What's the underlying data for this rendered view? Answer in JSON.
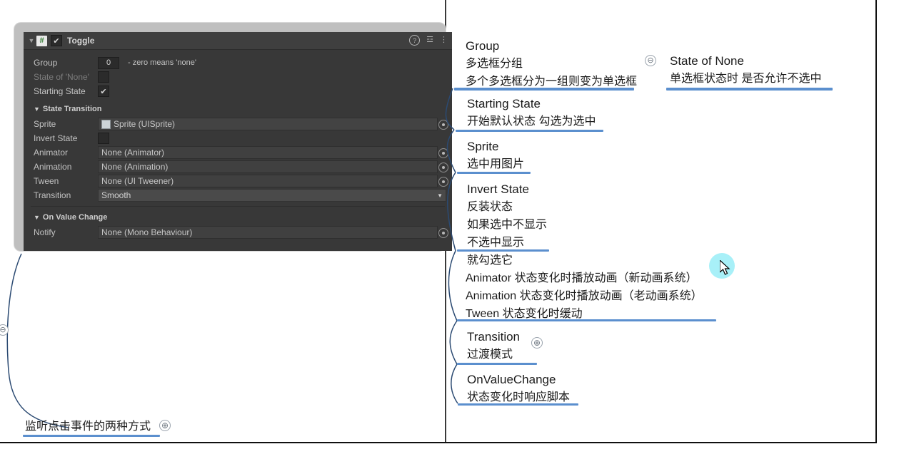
{
  "inspector": {
    "title": "Toggle",
    "foldout_arrow": "▼",
    "script_icon_glyph": "#",
    "enabled_check": "✔",
    "header_icons": {
      "help": "?",
      "preset": "☲",
      "menu": "⋮"
    },
    "rows": [
      {
        "label": "Group",
        "value": "0",
        "hint": "- zero means 'none'"
      },
      {
        "label": "State of 'None'",
        "value": "",
        "hint": ""
      },
      {
        "label": "Starting State",
        "value": "✔",
        "hint": ""
      }
    ],
    "sections": [
      {
        "title": "State Transition",
        "fields": [
          {
            "label": "Sprite",
            "value": "Sprite (UISprite)",
            "kind": "object-sprite"
          },
          {
            "label": "Invert State",
            "value": "",
            "kind": "checkbox"
          },
          {
            "label": "Animator",
            "value": "None (Animator)",
            "kind": "object"
          },
          {
            "label": "Animation",
            "value": "None (Animation)",
            "kind": "object"
          },
          {
            "label": "Tween",
            "value": "None (UI Tweener)",
            "kind": "object"
          },
          {
            "label": "Transition",
            "value": "Smooth",
            "kind": "dropdown"
          }
        ]
      },
      {
        "title": "On Value Change",
        "fields": [
          {
            "label": "Notify",
            "value": "None (Mono Behaviour)",
            "kind": "object"
          }
        ]
      }
    ],
    "dropdown_caret": "▼"
  },
  "mindmap": {
    "nodes": {
      "group": {
        "title": "Group",
        "line1": "多选框分组",
        "line2": "多个多选框分为一组则变为单选框"
      },
      "state_of_none": {
        "title": "State of None",
        "line1": "单选框状态时 是否允许不选中"
      },
      "starting_state": {
        "title": "Starting State",
        "line1": "开始默认状态 勾选为选中"
      },
      "sprite": {
        "title": "Sprite",
        "line1": "选中用图片"
      },
      "invert_state": {
        "title": "Invert State",
        "line1": "反装状态",
        "line2": "如果选中不显示",
        "line3": "不选中显示",
        "line4": "就勾选它"
      },
      "animation_group": {
        "line1": "Animator  状态变化时播放动画（新动画系统）",
        "line2": "Animation  状态变化时播放动画（老动画系统）",
        "line3": "Tween  状态变化时缓动"
      },
      "transition": {
        "title": "Transition",
        "line1": "过渡模式"
      },
      "on_value_change": {
        "title": "OnValueChange",
        "line1": "状态变化时响应脚本"
      },
      "click_listen": {
        "title": "监听点击事件的两种方式"
      }
    },
    "collapse_glyph": "⊖",
    "expand_glyph": "⊕"
  },
  "colors": {
    "branch_blue": "#5b8fce",
    "connector": "#2b4a72",
    "inspector_bg": "#383838",
    "click_halo": "#a8f0f8"
  }
}
